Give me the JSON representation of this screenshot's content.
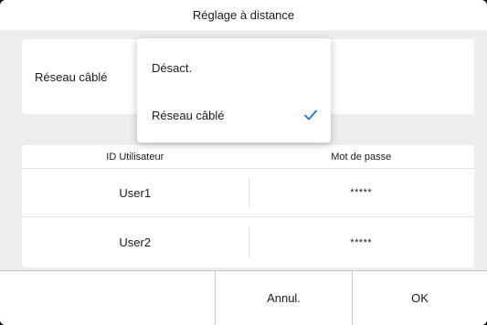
{
  "dialog": {
    "title": "Réglage à distance"
  },
  "network": {
    "label": "Réseau câblé",
    "dropdown": {
      "options": [
        {
          "label": "Désact.",
          "selected": false
        },
        {
          "label": "Réseau câblé",
          "selected": true
        }
      ]
    }
  },
  "users_table": {
    "headers": [
      "ID Utilisateur",
      "Mot de passe"
    ],
    "rows": [
      {
        "user": "User1",
        "password": "*****"
      },
      {
        "user": "User2",
        "password": "*****"
      }
    ]
  },
  "footer": {
    "cancel_label": "Annul.",
    "ok_label": "OK"
  },
  "colors": {
    "accent": "#1a73e8",
    "background": "#eeeeee",
    "card": "#ffffff"
  },
  "icons": {
    "selected_check": "checkmark-icon"
  }
}
